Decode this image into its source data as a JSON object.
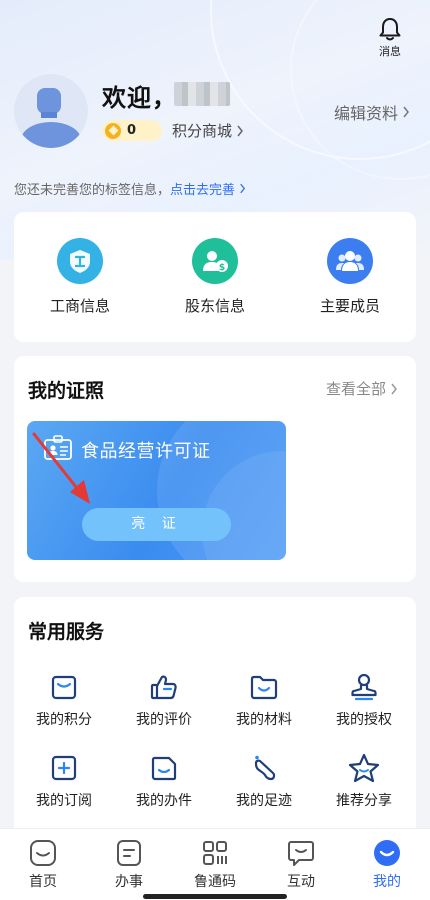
{
  "header": {
    "message_label": "消息",
    "welcome": "欢迎，",
    "points_value": "0",
    "points_mall": "积分商城",
    "edit_profile": "编辑资料",
    "tag_tip": "您还未完善您的标签信息，",
    "tag_link": "点击去完善"
  },
  "info": {
    "items": [
      {
        "label": "工商信息",
        "icon": "business-info-icon"
      },
      {
        "label": "股东信息",
        "icon": "shareholder-icon"
      },
      {
        "label": "主要成员",
        "icon": "members-icon"
      }
    ]
  },
  "certs": {
    "title": "我的证照",
    "view_all": "查看全部",
    "license_name": "食品经营许可证",
    "show_button": "亮 证"
  },
  "services": {
    "title": "常用服务",
    "items": [
      {
        "label": "我的积分",
        "icon": "bag-icon"
      },
      {
        "label": "我的评价",
        "icon": "thumbs-up-icon"
      },
      {
        "label": "我的材料",
        "icon": "folder-icon"
      },
      {
        "label": "我的授权",
        "icon": "stamp-icon"
      },
      {
        "label": "我的订阅",
        "icon": "subscribe-icon"
      },
      {
        "label": "我的办件",
        "icon": "document-icon"
      },
      {
        "label": "我的足迹",
        "icon": "footprint-icon"
      },
      {
        "label": "推荐分享",
        "icon": "star-icon"
      }
    ]
  },
  "tabbar": {
    "items": [
      {
        "label": "首页",
        "icon": "home-icon"
      },
      {
        "label": "办事",
        "icon": "task-icon"
      },
      {
        "label": "鲁通码",
        "icon": "qrcode-icon"
      },
      {
        "label": "互动",
        "icon": "chat-icon"
      },
      {
        "label": "我的",
        "icon": "profile-icon"
      }
    ],
    "active_index": 4
  },
  "colors": {
    "accent": "#2f6df6",
    "license_card": "#3b8cf0",
    "icon_stroke": "#1f3f7a"
  }
}
